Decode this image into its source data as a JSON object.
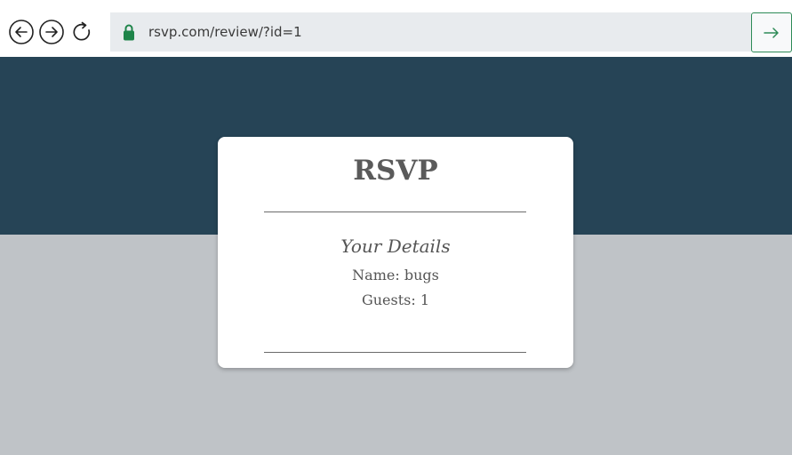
{
  "browser": {
    "url": "rsvp.com/review/?id=1",
    "icons": {
      "back": "back-arrow-icon",
      "forward": "forward-arrow-icon",
      "reload": "reload-icon",
      "lock": "lock-icon",
      "go": "go-arrow-icon"
    },
    "colors": {
      "lock": "#1e8449",
      "go_border": "#2e8b57"
    }
  },
  "page": {
    "colors": {
      "hero": "#264456",
      "background": "#bfc3c7",
      "card": "#ffffff"
    },
    "card": {
      "title": "RSVP",
      "section_heading": "Your Details",
      "name_line": "Name: bugs",
      "guests_line": "Guests: 1"
    }
  }
}
